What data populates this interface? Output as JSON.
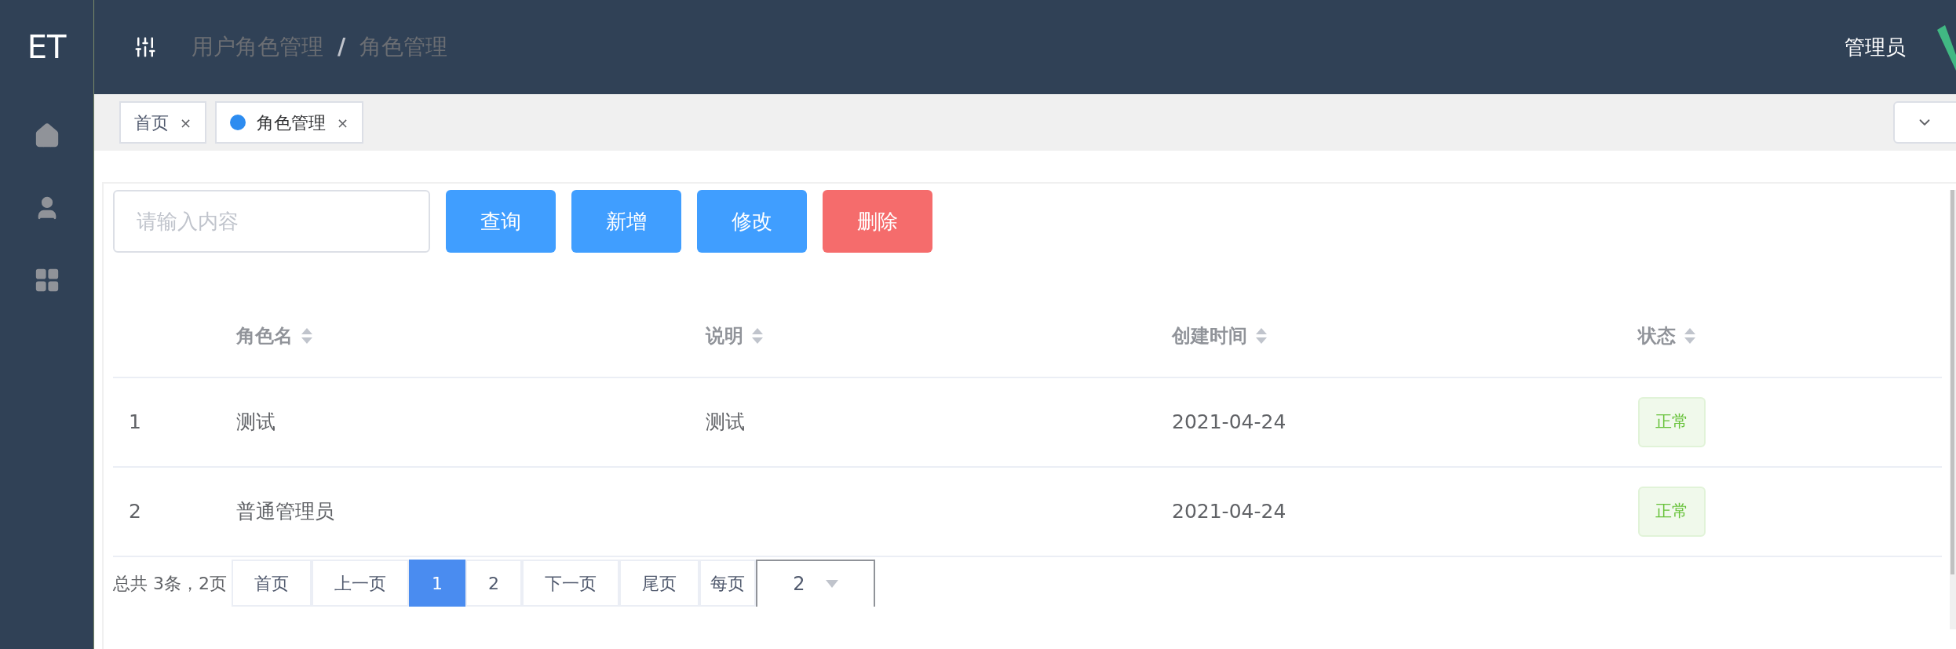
{
  "sidebar": {
    "logo": "ET"
  },
  "header": {
    "breadcrumb": [
      "用户角色管理",
      "角色管理"
    ],
    "separator": "/",
    "user": "管理员"
  },
  "tabs": [
    {
      "label": "首页",
      "selected": false,
      "close": "×"
    },
    {
      "label": "角色管理",
      "selected": true,
      "close": "×"
    }
  ],
  "toolbar": {
    "search": {
      "placeholder": "请输入内容"
    },
    "buttons": [
      {
        "label": "查询",
        "kind": "primary"
      },
      {
        "label": "新增",
        "kind": "primary"
      },
      {
        "label": "修改",
        "kind": "primary"
      },
      {
        "label": "删除",
        "kind": "danger"
      }
    ]
  },
  "table": {
    "columns": [
      "角色名",
      "说明",
      "创建时间",
      "状态"
    ],
    "rows": [
      {
        "index": "1",
        "name": "测试",
        "description": "测试",
        "created": "2021-04-24",
        "status": "正常"
      },
      {
        "index": "2",
        "name": "普通管理员",
        "created": "2021-04-24",
        "status": "正常"
      }
    ]
  },
  "pagination": {
    "summary": "总共 3条，2页",
    "items": [
      {
        "label": "首页",
        "selected": false
      },
      {
        "label": "上一页",
        "selected": false
      },
      {
        "label": "1",
        "selected": true
      },
      {
        "label": "2",
        "selected": false
      },
      {
        "label": "下一页",
        "selected": false
      },
      {
        "label": "尾页",
        "selected": false
      }
    ],
    "per_page_label": "每页",
    "per_page_value": "2"
  }
}
